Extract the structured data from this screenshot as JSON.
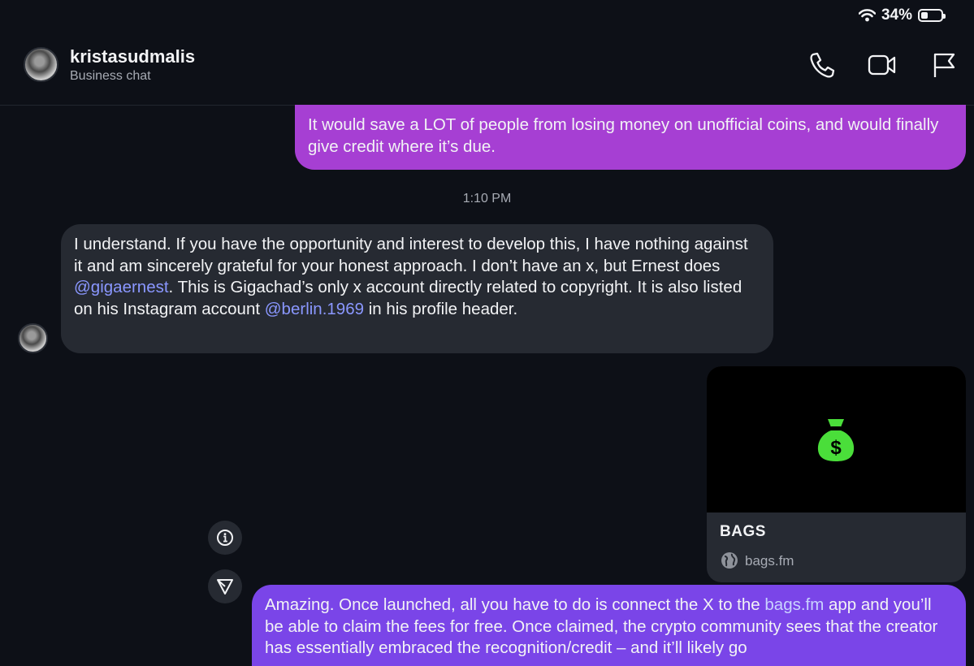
{
  "status_bar": {
    "wifi_icon": "wifi-icon",
    "battery_percent": "34%",
    "battery_level": 0.34
  },
  "header": {
    "contact_name": "kristasudmalis",
    "subtitle": "Business chat",
    "actions": [
      "phone-icon",
      "video-icon",
      "flag-icon"
    ]
  },
  "messages": {
    "outgoing_1": "It would save a LOT of people from losing money on unofficial coins, and would finally give credit where it’s due.",
    "timestamp": "1:10 PM",
    "incoming": {
      "part1": "I understand. If you have the opportunity and interest to develop this, I have nothing against it and am sincerely grateful for your honest approach. I don’t have an x, but Ernest does ",
      "mention1": "@gigaernest",
      "part2": ". This is Gigachad’s only x account directly related to copyright. It is also listed on his Instagram account ",
      "mention2": "@berlin.1969",
      "part3": " in his profile header."
    },
    "link_card": {
      "title": "BAGS",
      "domain": "bags.fm",
      "image_icon": "money-bag-icon",
      "accent": "#4ade3a"
    },
    "outgoing_2": {
      "part1": "Amazing. Once launched, all you have to do is connect the X to the ",
      "link": "bags.fm",
      "part2": " app and you’ll be able to claim the fees for free. Once claimed, the crypto community sees that the creator has essentially embraced the recognition/credit – and it’ll likely go"
    }
  },
  "side_actions": [
    "info-icon",
    "send-icon"
  ],
  "colors": {
    "background": "#0d1017",
    "outgoing_1": "#a63fd3",
    "outgoing_2": "#7a45e8",
    "incoming": "#262a32",
    "mention": "#8a97ff"
  }
}
